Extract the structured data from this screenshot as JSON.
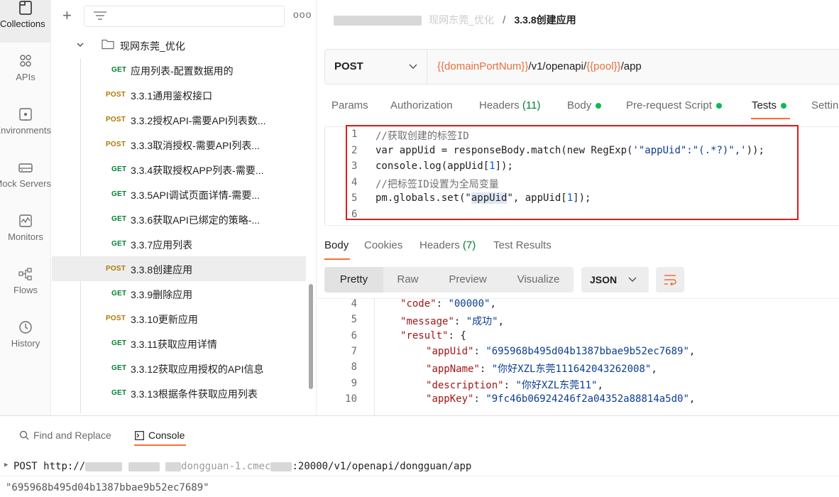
{
  "rail": {
    "items": [
      {
        "label": "Collections",
        "icon": "collections-icon",
        "active": true
      },
      {
        "label": "APIs",
        "icon": "apis-icon"
      },
      {
        "label": "Environments",
        "icon": "environments-icon"
      },
      {
        "label": "Mock Servers",
        "icon": "mock-servers-icon"
      },
      {
        "label": "Monitors",
        "icon": "monitors-icon"
      },
      {
        "label": "Flows",
        "icon": "flows-icon"
      },
      {
        "label": "History",
        "icon": "history-icon"
      }
    ]
  },
  "sidebar": {
    "more_label": "ooo",
    "folder_name": "现网东莞_优化",
    "requests": [
      {
        "method": "GET",
        "name": "应用列表-配置数据用的"
      },
      {
        "method": "POST",
        "name": "3.3.1通用鉴权接口"
      },
      {
        "method": "POST",
        "name": "3.3.2授权API-需要API列表数..."
      },
      {
        "method": "POST",
        "name": "3.3.3取消授权-需要API列表..."
      },
      {
        "method": "GET",
        "name": "3.3.4获取授权APP列表-需要..."
      },
      {
        "method": "GET",
        "name": "3.3.5API调试页面详情-需要..."
      },
      {
        "method": "GET",
        "name": "3.3.6获取API已绑定的策略-..."
      },
      {
        "method": "GET",
        "name": "3.3.7应用列表"
      },
      {
        "method": "POST",
        "name": "3.3.8创建应用",
        "active": true
      },
      {
        "method": "GET",
        "name": "3.3.9删除应用"
      },
      {
        "method": "POST",
        "name": "3.3.10更新应用"
      },
      {
        "method": "GET",
        "name": "3.3.11获取应用详情"
      },
      {
        "method": "GET",
        "name": "3.3.12获取应用授权的API信息"
      },
      {
        "method": "GET",
        "name": "3.3.13根据条件获取应用列表"
      }
    ]
  },
  "breadcrumb": {
    "folder": "现网东莞_优化",
    "separator": "/",
    "current": "3.3.8创建应用"
  },
  "request": {
    "method": "POST",
    "url_parts": [
      {
        "text": "{{domainPortNum}}",
        "var": true
      },
      {
        "text": "/v1/openapi/",
        "var": false
      },
      {
        "text": "{{pool}}",
        "var": true
      },
      {
        "text": "/app",
        "var": false
      }
    ]
  },
  "request_tabs": [
    {
      "label": "Params"
    },
    {
      "label": "Authorization"
    },
    {
      "label": "Headers",
      "count": "(11)"
    },
    {
      "label": "Body",
      "dot": true
    },
    {
      "label": "Pre-request Script",
      "dot": true
    },
    {
      "label": "Tests",
      "dot": true,
      "active": true
    },
    {
      "label": "Settin"
    }
  ],
  "tests_code": [
    {
      "n": "1",
      "text": "//获取创建的标签ID"
    },
    {
      "n": "2",
      "text": "var appUid = responseBody.match(new RegExp('\"appUid\":\"(.*?)\",'));"
    },
    {
      "n": "3",
      "text": "console.log(appUid[1]);"
    },
    {
      "n": "4",
      "text": "//把标签ID设置为全局变量"
    },
    {
      "n": "5",
      "text": "pm.globals.set(\"appUid\", appUid[1]);"
    },
    {
      "n": "6",
      "text": ""
    }
  ],
  "response_tabs": [
    {
      "label": "Body",
      "active": true
    },
    {
      "label": "Cookies"
    },
    {
      "label": "Headers",
      "count": "(7)"
    },
    {
      "label": "Test Results"
    }
  ],
  "view_modes": [
    "Pretty",
    "Raw",
    "Preview",
    "Visualize"
  ],
  "format": "JSON",
  "response_lines": [
    {
      "n": "4",
      "indent": 1,
      "key": "code",
      "value": "\"00000\"",
      "comma": true
    },
    {
      "n": "5",
      "indent": 1,
      "key": "message",
      "value": "\"成功\"",
      "comma": true
    },
    {
      "n": "6",
      "indent": 1,
      "key": "result",
      "value": "{",
      "comma": false
    },
    {
      "n": "7",
      "indent": 2,
      "key": "appUid",
      "value": "\"695968b495d04b1387bbae9b52ec7689\"",
      "comma": true
    },
    {
      "n": "8",
      "indent": 2,
      "key": "appName",
      "value": "\"你好XZL东莞111642043262008\"",
      "comma": true
    },
    {
      "n": "9",
      "indent": 2,
      "key": "description",
      "value": "\"你好XZL东莞11\"",
      "comma": true
    },
    {
      "n": "10",
      "indent": 2,
      "key": "appKey",
      "value": "\"9fc46b06924246f2a04352a88814a5d0\"",
      "comma": true
    }
  ],
  "bottom": {
    "find_replace_label": "Find and Replace",
    "console_label": "Console",
    "console_lines": [
      {
        "method": "POST",
        "url_prefix": "http://",
        "url_mid": "dongguan-1.cmec",
        "url_suffix": ":20000/v1/openapi/dongguan/app"
      },
      {
        "text": "\"695968b495d04b1387bbae9b52ec7689\""
      }
    ]
  }
}
